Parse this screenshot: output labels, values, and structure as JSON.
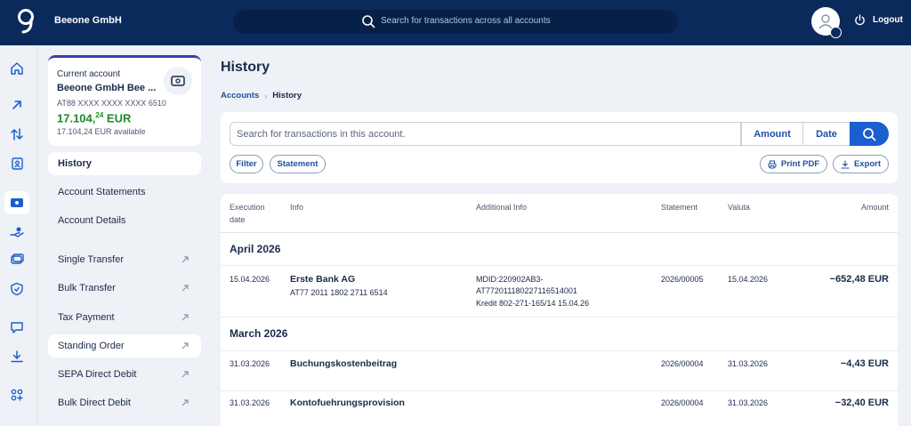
{
  "header": {
    "company": "Beeone GmbH",
    "search_placeholder": "Search for transactions across all accounts",
    "logout_label": "Logout"
  },
  "account": {
    "label": "Current account",
    "name": "Beeone GmbH Bee ...",
    "iban": "AT88 XXXX XXXX XXXX 6510",
    "balance_main": "17.104,",
    "balance_cents": "24",
    "balance_currency": " EUR",
    "available": "17.104,24 EUR available"
  },
  "sidebar": {
    "items": [
      {
        "label": "History"
      },
      {
        "label": "Account Statements"
      },
      {
        "label": "Account Details"
      },
      {
        "label": "Single Transfer"
      },
      {
        "label": "Bulk Transfer"
      },
      {
        "label": "Tax Payment"
      },
      {
        "label": "Standing Order"
      },
      {
        "label": "SEPA Direct Debit"
      },
      {
        "label": "Bulk Direct Debit"
      }
    ]
  },
  "rail_icons": [
    "home-icon",
    "arrow-up-right-icon",
    "transfer-icon",
    "contacts-icon",
    "card-icon",
    "hand-money-icon",
    "cards-icon",
    "shield-icon",
    "chat-icon",
    "download-icon",
    "apps-icon"
  ],
  "page": {
    "title": "History",
    "breadcrumb": {
      "parent": "Accounts",
      "current": "History"
    }
  },
  "filters": {
    "search_placeholder": "Search for transactions in this account.",
    "amount_label": "Amount",
    "date_label": "Date",
    "filter_label": "Filter",
    "statement_label": "Statement",
    "print_label": "Print PDF",
    "export_label": "Export"
  },
  "table": {
    "columns": {
      "execution_1": "Execution",
      "execution_2": "date",
      "info": "Info",
      "additional": "Additional Info",
      "statement": "Statement",
      "valuta": "Valuta",
      "amount": "Amount"
    },
    "groups": [
      {
        "label": "April 2026",
        "rows": [
          {
            "date": "15.04.2026",
            "info": "Erste Bank AG",
            "info_sub": "AT77 2011 1802 2711 6514",
            "add_1": "MDID:220902AB3-",
            "add_2": "AT772011180227116514001",
            "add_3": "Kredit 802-271-165/14 15.04.26",
            "statement": "2026/00005",
            "valuta": "15.04.2026",
            "amount": "−652,48 EUR"
          }
        ]
      },
      {
        "label": "March 2026",
        "rows": [
          {
            "date": "31.03.2026",
            "info": "Buchungskostenbeitrag",
            "statement": "2026/00004",
            "valuta": "31.03.2026",
            "amount": "−4,43 EUR"
          },
          {
            "date": "31.03.2026",
            "info": "Kontofuehrungsprovision",
            "statement": "2026/00004",
            "valuta": "31.03.2026",
            "amount": "−32,40 EUR"
          }
        ]
      }
    ]
  },
  "colors": {
    "topbar": "#0b2a5c",
    "accent": "#1a5fd0",
    "balance": "#1e8a2a"
  }
}
